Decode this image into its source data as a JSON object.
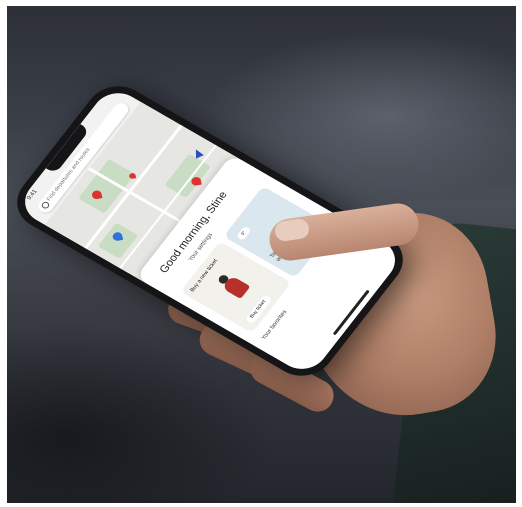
{
  "phone_screen": {
    "status_time": "9:41",
    "search": {
      "placeholder": "Find departures and routes"
    },
    "greeting": "Good morning, Stine",
    "settings_link": "Your settings",
    "cards": [
      {
        "title": "Buy a new ticket",
        "button_label": "Buy ticket"
      },
      {
        "chip": "9°",
        "text": "Take an umbrella with you today"
      }
    ],
    "favorites_label": "Your favorites"
  },
  "colors": {
    "map_pin_red": "#e03131",
    "map_pin_blue": "#2f6fde",
    "background": "#2d3038"
  }
}
